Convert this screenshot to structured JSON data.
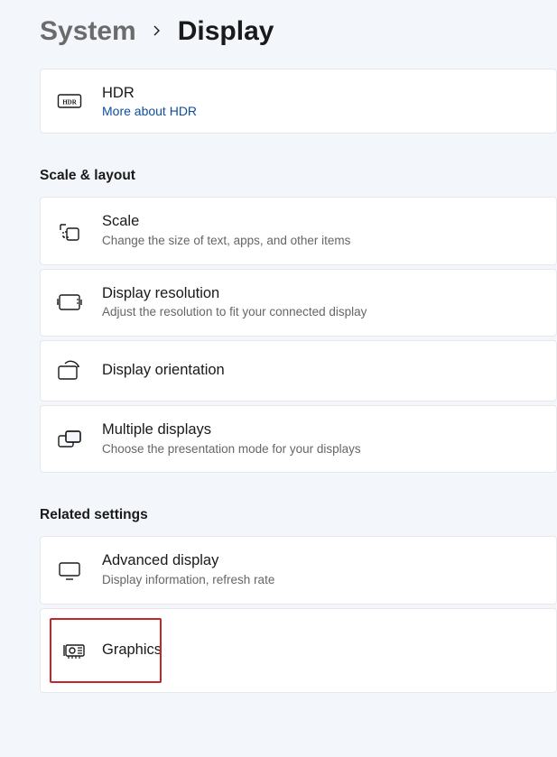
{
  "breadcrumb": {
    "parent": "System",
    "current": "Display"
  },
  "hdr": {
    "title": "HDR",
    "link": "More about HDR"
  },
  "sections": {
    "scale": {
      "title": "Scale & layout",
      "items": [
        {
          "title": "Scale",
          "sub": "Change the size of text, apps, and other items"
        },
        {
          "title": "Display resolution",
          "sub": "Adjust the resolution to fit your connected display"
        },
        {
          "title": "Display orientation",
          "sub": ""
        },
        {
          "title": "Multiple displays",
          "sub": "Choose the presentation mode for your displays"
        }
      ]
    },
    "related": {
      "title": "Related settings",
      "items": [
        {
          "title": "Advanced display",
          "sub": "Display information, refresh rate"
        },
        {
          "title": "Graphics",
          "sub": ""
        }
      ]
    }
  }
}
